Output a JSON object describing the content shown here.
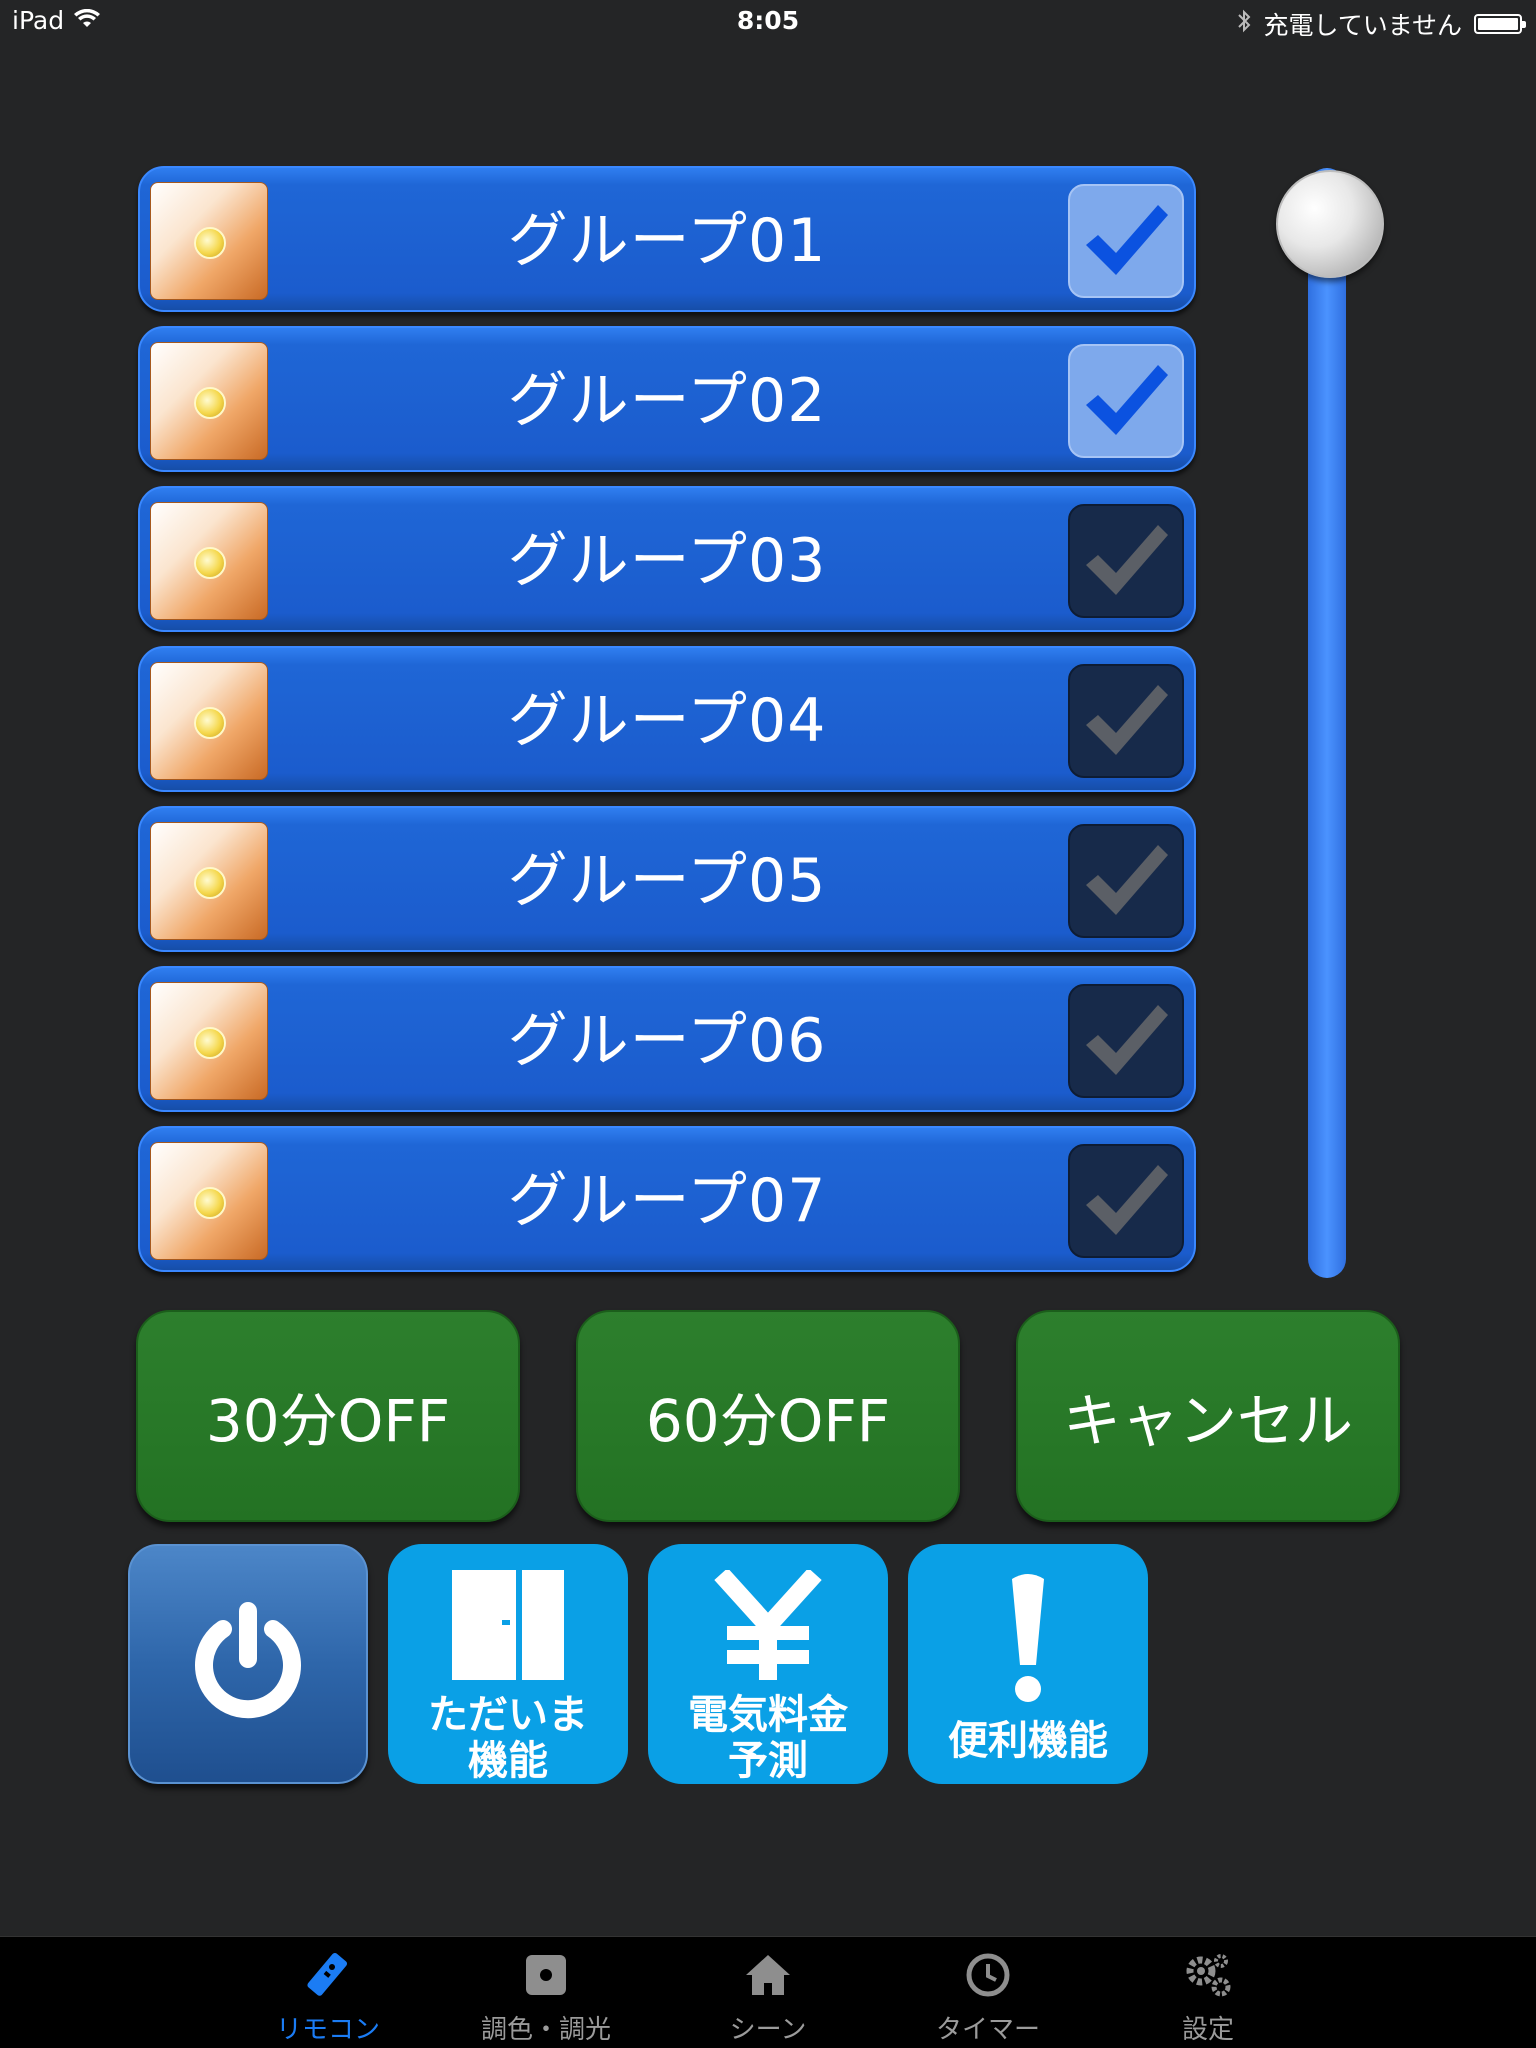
{
  "status_bar": {
    "device": "iPad",
    "time": "8:05",
    "battery_text": "充電していません"
  },
  "groups": [
    {
      "label": "グループ01",
      "checked": true
    },
    {
      "label": "グループ02",
      "checked": true
    },
    {
      "label": "グループ03",
      "checked": false
    },
    {
      "label": "グループ04",
      "checked": false
    },
    {
      "label": "グループ05",
      "checked": false
    },
    {
      "label": "グループ06",
      "checked": false
    },
    {
      "label": "グループ07",
      "checked": false
    }
  ],
  "timer_buttons": {
    "off30": "30分OFF",
    "off60": "60分OFF",
    "cancel": "キャンセル"
  },
  "function_buttons": {
    "tadaima_line1": "ただいま",
    "tadaima_line2": "機能",
    "electric_line1": "電気料金",
    "electric_line2": "予測",
    "convenience": "便利機能"
  },
  "tabs": [
    {
      "label": "リモコン",
      "icon": "remote-icon",
      "active": true
    },
    {
      "label": "調色・調光",
      "icon": "dimmer-icon",
      "active": false
    },
    {
      "label": "シーン",
      "icon": "home-icon",
      "active": false
    },
    {
      "label": "タイマー",
      "icon": "clock-icon",
      "active": false
    },
    {
      "label": "設定",
      "icon": "gear-icon",
      "active": false
    }
  ],
  "colors": {
    "background": "#242526",
    "row_blue": "#1f66d6",
    "timer_green": "#237223",
    "function_cyan": "#0aa0e6",
    "tab_active": "#1b7cf4"
  },
  "slider": {
    "position": 0.0
  }
}
